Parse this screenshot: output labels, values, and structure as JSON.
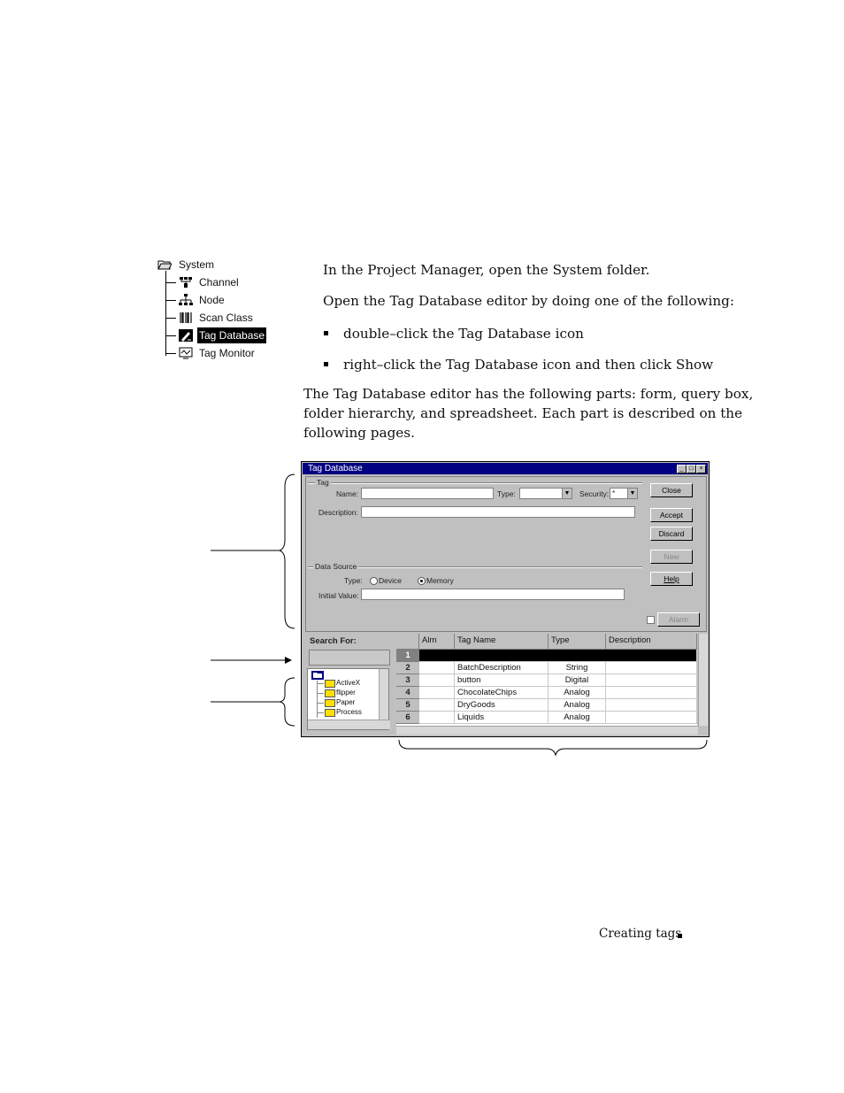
{
  "tree": {
    "root": "System",
    "items": [
      "Channel",
      "Node",
      "Scan Class",
      "Tag Database",
      "Tag Monitor"
    ]
  },
  "text": {
    "p1": "In the Project Manager, open the System folder.",
    "p2": "Open the Tag Database editor by doing one of the following:",
    "b1": "double–click the Tag Database icon",
    "b2": "right–click the Tag Database icon and then click Show",
    "p3_l1": "The Tag Database editor has the following parts: form, query box,",
    "p3_l2": "folder hierarchy, and spreadsheet. Each part is described on the",
    "p3_l3": "following pages."
  },
  "window": {
    "title": "Tag Database",
    "tag_group": "Tag",
    "name_label": "Name:",
    "type_label": "Type:",
    "security_label": "Security:",
    "security_value": "*",
    "description_label": "Description:",
    "datasource_group": "Data Source",
    "ds_type_label": "Type:",
    "device_label": "Device",
    "memory_label": "Memory",
    "initial_value_label": "Initial Value:",
    "buttons": {
      "close": "Close",
      "accept": "Accept",
      "discard": "Discard",
      "new": "New",
      "help": "Help",
      "alarm": "Alarm"
    },
    "search_for": "Search For:",
    "folders": [
      "ActiveX",
      "flipper",
      "Paper",
      "Process"
    ],
    "grid": {
      "headers": [
        "Alm",
        "Tag Name",
        "Type",
        "Description"
      ],
      "rows": [
        {
          "n": "1",
          "name": "",
          "type": ""
        },
        {
          "n": "2",
          "name": "BatchDescription",
          "type": "String"
        },
        {
          "n": "3",
          "name": "button",
          "type": "Digital"
        },
        {
          "n": "4",
          "name": "ChocolateChips",
          "type": "Analog"
        },
        {
          "n": "5",
          "name": "DryGoods",
          "type": "Analog"
        },
        {
          "n": "6",
          "name": "Liquids",
          "type": "Analog"
        }
      ]
    }
  },
  "footer": {
    "text": "Creating tags"
  }
}
